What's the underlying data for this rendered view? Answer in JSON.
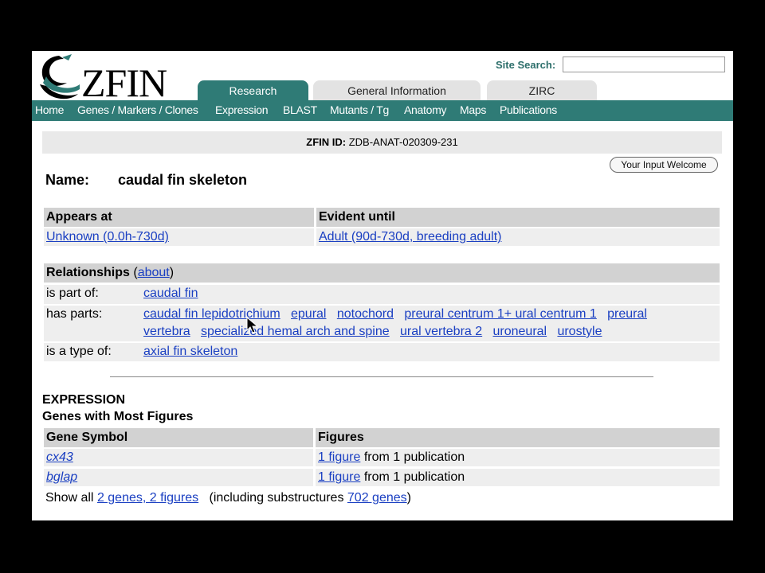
{
  "header": {
    "logo_text": "ZFIN",
    "site_search_label": "Site Search:",
    "site_search_value": ""
  },
  "tabs": [
    "Research",
    "General Information",
    "ZIRC"
  ],
  "nav": [
    "Home",
    "Genes / Markers / Clones",
    "Expression",
    "BLAST",
    "Mutants / Tg",
    "Anatomy",
    "Maps",
    "Publications"
  ],
  "id_bar": {
    "label": "ZFIN ID:",
    "value": "ZDB-ANAT-020309-231"
  },
  "input_welcome": "Your Input Welcome",
  "name": {
    "label": "Name:",
    "value": "caudal fin skeleton"
  },
  "stages": {
    "headers": [
      "Appears at",
      "Evident until"
    ],
    "appears_at": "Unknown (0.0h-730d)",
    "evident_until": "Adult (90d-730d, breeding adult)"
  },
  "relationships": {
    "title": "Relationships",
    "about_open": "(",
    "about": "about",
    "about_close": ")",
    "part_of_label": "is part of:",
    "part_of": "caudal fin",
    "has_parts_label": "has parts:",
    "has_parts_line1": [
      "caudal fin lepidotrichium",
      "epural",
      "notochord",
      "preural centrum 1+ ural centrum 1",
      "preural"
    ],
    "has_parts_line2": [
      "vertebra",
      "specialized hemal arch and spine",
      "ural vertebra 2",
      "uroneural",
      "urostyle"
    ],
    "type_of_label": "is a type of:",
    "type_of": "axial fin skeleton"
  },
  "expression": {
    "title": "EXPRESSION",
    "subtitle": "Genes with Most Figures",
    "headers": [
      "Gene Symbol",
      "Figures"
    ],
    "rows": [
      {
        "gene": "cx43",
        "fig_link": "1 figure",
        "fig_text": " from 1 publication"
      },
      {
        "gene": "bglap",
        "fig_link": "1 figure",
        "fig_text": " from 1 publication"
      }
    ],
    "show_all_prefix": "Show all",
    "show_all_link": "2 genes, 2 figures",
    "including_prefix": "(including substructures",
    "including_link": "702 genes",
    "including_suffix": ")"
  },
  "colors": {
    "teal": "#2f7b76",
    "link": "#1a3fc2",
    "header_gray": "#d2d2d2",
    "row_gray": "#eeeeee"
  }
}
